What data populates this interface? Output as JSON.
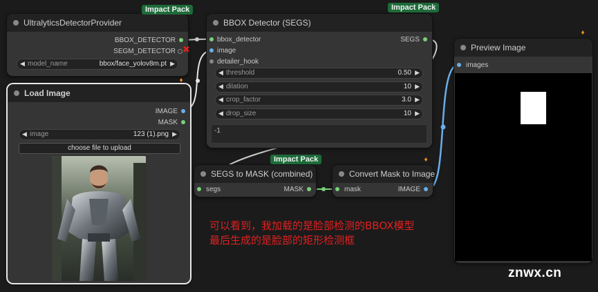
{
  "nodes": {
    "ultralytics": {
      "title": "UltralyticsDetectorProvider",
      "badge": "Impact Pack",
      "outputs": [
        "BBOX_DETECTOR",
        "SEGM_DETECTOR"
      ],
      "widget": {
        "label": "model_name",
        "value": "bbox/face_yolov8m.pt"
      }
    },
    "load_image": {
      "title": "Load Image",
      "outputs": [
        "IMAGE",
        "MASK"
      ],
      "widget": {
        "label": "image",
        "value": "123 (1).png"
      },
      "button": "choose file to upload"
    },
    "bbox_detector": {
      "title": "BBOX Detector (SEGS)",
      "badge": "Impact Pack",
      "inputs": [
        "bbox_detector",
        "image",
        "detailer_hook"
      ],
      "output": "SEGS",
      "widgets": [
        {
          "label": "threshold",
          "value": "0.50"
        },
        {
          "label": "dilation",
          "value": "10"
        },
        {
          "label": "crop_factor",
          "value": "3.0"
        },
        {
          "label": "drop_size",
          "value": "10"
        }
      ],
      "text": "-1"
    },
    "segs_to_mask": {
      "title": "SEGS to MASK (combined)",
      "badge": "Impact Pack",
      "input": "segs",
      "output": "MASK"
    },
    "convert_mask": {
      "title": "Convert Mask to Image",
      "input": "mask",
      "output": "IMAGE"
    },
    "preview": {
      "title": "Preview Image",
      "input": "images"
    }
  },
  "annotation": {
    "line1": "可以看到，我加载的是脸部检测的BBOX模型",
    "line2": "最后生成的是脸部的矩形检测框"
  },
  "watermark": "znwx.cn",
  "colors": {
    "image_wire": "#6aaeea",
    "generic_wire": "#d8d8d8",
    "mask_wire": "#7ad17a",
    "error_x": "#e02020",
    "badge": "#1e6b3a"
  }
}
